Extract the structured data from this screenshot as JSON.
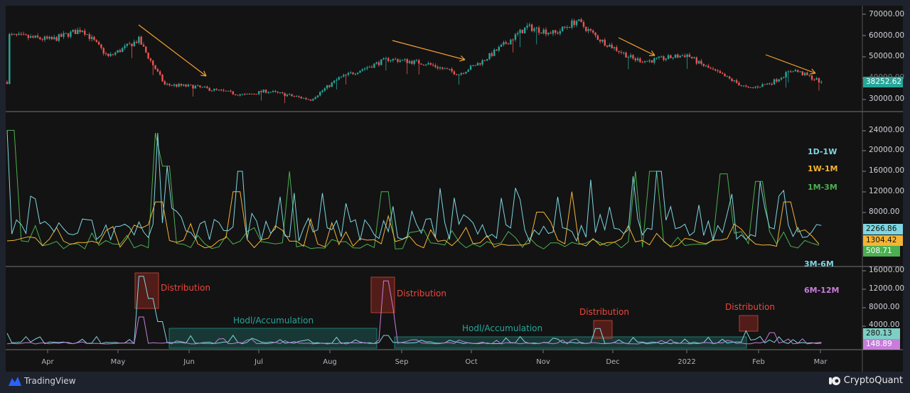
{
  "chart_data": {
    "type": "line",
    "x_ticks": [
      "Apr",
      "May",
      "Jun",
      "Jul",
      "Aug",
      "Sep",
      "Oct",
      "Nov",
      "Dec",
      "2022",
      "Feb",
      "Mar"
    ],
    "panes": [
      {
        "name": "price",
        "type": "candlestick",
        "y_ticks": [
          "70000.00",
          "60000.00",
          "50000.00",
          "40000.00",
          "30000.00"
        ],
        "ylim": [
          27000,
          72000
        ],
        "last_value": "38252.62",
        "approx_close_by_date": [
          [
            "2021-03-14",
            60000
          ],
          [
            "2021-04-01",
            58000
          ],
          [
            "2021-04-14",
            63000
          ],
          [
            "2021-04-25",
            50000
          ],
          [
            "2021-05-08",
            58000
          ],
          [
            "2021-05-12",
            50000
          ],
          [
            "2021-05-19",
            37000
          ],
          [
            "2021-06-01",
            36000
          ],
          [
            "2021-06-22",
            32000
          ],
          [
            "2021-07-01",
            34000
          ],
          [
            "2021-07-20",
            30000
          ],
          [
            "2021-08-01",
            40000
          ],
          [
            "2021-08-22",
            49000
          ],
          [
            "2021-09-07",
            47000
          ],
          [
            "2021-09-21",
            42000
          ],
          [
            "2021-10-01",
            48000
          ],
          [
            "2021-10-20",
            64000
          ],
          [
            "2021-11-01",
            61000
          ],
          [
            "2021-11-10",
            67000
          ],
          [
            "2021-11-20",
            58000
          ],
          [
            "2021-12-04",
            49000
          ],
          [
            "2021-12-10",
            48000
          ],
          [
            "2021-12-27",
            51000
          ],
          [
            "2022-01-01",
            47000
          ],
          [
            "2022-01-22",
            35000
          ],
          [
            "2022-02-01",
            38000
          ],
          [
            "2022-02-10",
            44000
          ],
          [
            "2022-02-22",
            38250
          ]
        ]
      },
      {
        "name": "short-term",
        "y_ticks": [
          "24000.00",
          "20000.00",
          "16000.00",
          "12000.00",
          "8000.00"
        ],
        "ylim": [
          0,
          27000
        ],
        "series": [
          {
            "name": "1D-1W",
            "color": "#7fd6e0",
            "last_value": "2266.86",
            "peak": 23500
          },
          {
            "name": "1W-1M",
            "color": "#f5b532",
            "last_value": "1304.42",
            "peak": 12000
          },
          {
            "name": "1M-3M",
            "color": "#4caf50",
            "last_value": "508.71",
            "peak": 5000
          }
        ]
      },
      {
        "name": "mid-term",
        "y_ticks": [
          "16000.00",
          "12000.00",
          "8000.00",
          "4000.00"
        ],
        "ylim": [
          0,
          17000
        ],
        "series": [
          {
            "name": "3M-6M",
            "color": "#7fd6e0",
            "last_value": "280.13",
            "peak": 14800
          },
          {
            "name": "6M-12M",
            "color": "#c77ddb",
            "last_value": "148.89",
            "peak": 13800
          }
        ]
      }
    ],
    "annotations": [
      "Distribution",
      "Hodl/Accumulation",
      "Distribution",
      "Hodl/Accumulation",
      "Distribution",
      "Distribution"
    ]
  },
  "colors": {
    "up": "#26a69a",
    "down": "#ef5350",
    "arrow": "#f5a030",
    "distribution": "#f0463c",
    "hodl": "#26a69a"
  },
  "footer": {
    "left_brand": "TradingView",
    "right_brand": "CryptoQuant"
  }
}
